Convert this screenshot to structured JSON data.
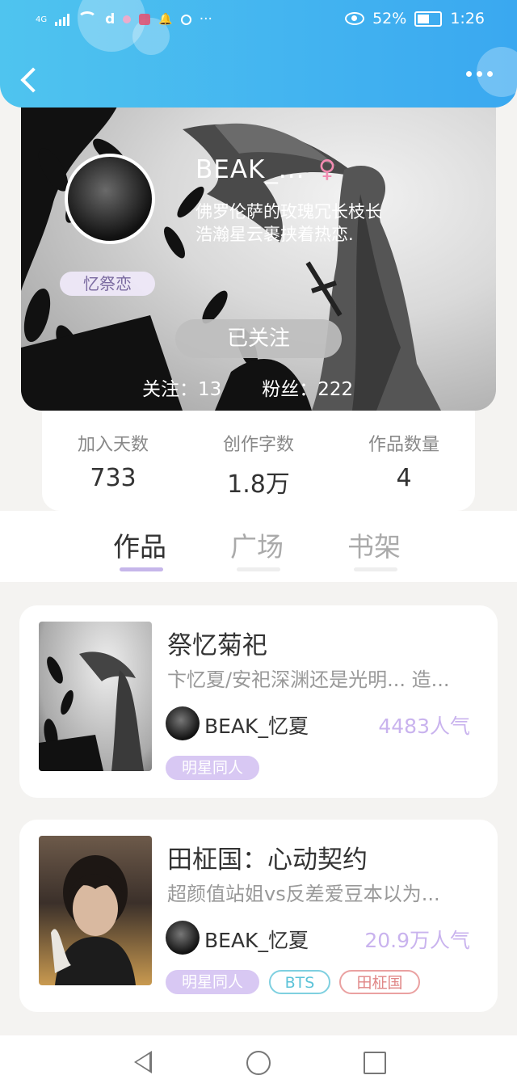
{
  "status_bar": {
    "network": "4G",
    "battery": "52%",
    "time": "1:26"
  },
  "header": {
    "back_icon": "chevron-left-icon",
    "more_icon": "more-horizontal-icon"
  },
  "profile": {
    "name": "BEAK_...",
    "gender_symbol": "♀",
    "bio_line1": "佛罗伦萨的玫瑰冗长枝长",
    "bio_line2": "浩瀚星云裹挟着热恋.",
    "badge": "忆祭恋",
    "follow_button": "已关注",
    "following_label": "关注：",
    "following_count": "13",
    "fans_label": "粉丝：",
    "fans_count": "222"
  },
  "stats": [
    {
      "label": "加入天数",
      "value": "733"
    },
    {
      "label": "创作字数",
      "value": "1.8万"
    },
    {
      "label": "作品数量",
      "value": "4"
    }
  ],
  "tabs": [
    {
      "label": "作品",
      "active": true
    },
    {
      "label": "广场",
      "active": false
    },
    {
      "label": "书架",
      "active": false
    }
  ],
  "works": [
    {
      "title": "祭忆菊祀",
      "desc": "卞忆夏/安祀深渊还是光明... 造...",
      "author": "BEAK_忆夏",
      "popularity": "4483人气",
      "tags": [
        "明星同人"
      ]
    },
    {
      "title": "田柾国：心动契约",
      "desc": "超颜值站姐vs反差爱豆本以为...",
      "author": "BEAK_忆夏",
      "popularity": "20.9万人气",
      "tags": [
        "明星同人",
        "BTS",
        "田柾国"
      ]
    }
  ],
  "colors": {
    "header_gradient_start": "#4fc4ef",
    "header_gradient_end": "#3aa8f0",
    "accent_purple": "#c6b6ea",
    "popularity": "#c9b3ee",
    "tag_teal": "#5cc3d8",
    "tag_red": "#e08686"
  }
}
